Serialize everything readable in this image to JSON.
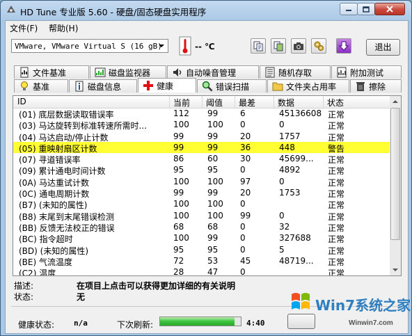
{
  "window": {
    "title": "HD Tune 专业版 5.60 - 硬盘/固态硬盘实用程序"
  },
  "menu": {
    "file": "文件(F)",
    "help": "帮助(H)"
  },
  "toolbar": {
    "drive": "VMware, VMware Virtual S (16 gB)",
    "temperature": "-- ℃",
    "exit_label": "退出"
  },
  "tabs_top": [
    "文件基准",
    "磁盘监视器",
    "自动噪音管理",
    "随机存取",
    "附加测试"
  ],
  "tabs_bottom": [
    "基准",
    "磁盘信息",
    "健康",
    "错误扫描",
    "文件夹占用率",
    "擦除"
  ],
  "table": {
    "columns": [
      "ID",
      "当前",
      "阈值",
      "最差",
      "数据",
      "状态"
    ],
    "rows": [
      [
        "(01) 底层数据读取错误率",
        "112",
        "99",
        "6",
        "45136608",
        "正常"
      ],
      [
        "(03) 马达旋转到标准转速所需时...",
        "100",
        "100",
        "0",
        "0",
        "正常"
      ],
      [
        "(04) 马达启动/停止计数",
        "99",
        "99",
        "20",
        "1757",
        "正常"
      ],
      [
        "(05) 重映射扇区计数",
        "99",
        "99",
        "36",
        "448",
        "警告"
      ],
      [
        "(07) 寻道错误率",
        "86",
        "60",
        "30",
        "45699...",
        "正常"
      ],
      [
        "(09) 累计通电时间计数",
        "95",
        "95",
        "0",
        "4892",
        "正常"
      ],
      [
        "(0A) 马达重试计数",
        "100",
        "100",
        "97",
        "0",
        "正常"
      ],
      [
        "(0C) 通电周期计数",
        "99",
        "99",
        "20",
        "1753",
        "正常"
      ],
      [
        "(B7) (未知的属性)",
        "100",
        "100",
        "0",
        "",
        "正常"
      ],
      [
        "(B8) 末尾到末尾错误检测",
        "100",
        "100",
        "99",
        "0",
        "正常"
      ],
      [
        "(BB) 反馈无法校正的错误",
        "68",
        "68",
        "0",
        "32",
        "正常"
      ],
      [
        "(BC) 指令超时",
        "100",
        "99",
        "0",
        "327688",
        "正常"
      ],
      [
        "(BD) (未知的属性)",
        "95",
        "95",
        "0",
        "5",
        "正常"
      ],
      [
        "(BE) 气流温度",
        "72",
        "53",
        "45",
        "48719...",
        "正常"
      ],
      [
        "(C2) 温度",
        "28",
        "47",
        "0",
        "",
        "正常"
      ]
    ],
    "highlight_row": 3,
    "highlight_color": "#ffff33"
  },
  "details": {
    "desc_label": "描述:",
    "desc_text": "在项目上点击可以获得更加详细的有关说明",
    "state_label": "状态:",
    "state_text": "无"
  },
  "status": {
    "health_label": "健康状态:",
    "health_value": "n/a",
    "refresh_label": "下次刷新:",
    "refresh_progress": 0.92,
    "refresh_time": "4:40"
  },
  "watermark": {
    "brand": "Win7系统之家",
    "url": "Winwin7.com"
  }
}
